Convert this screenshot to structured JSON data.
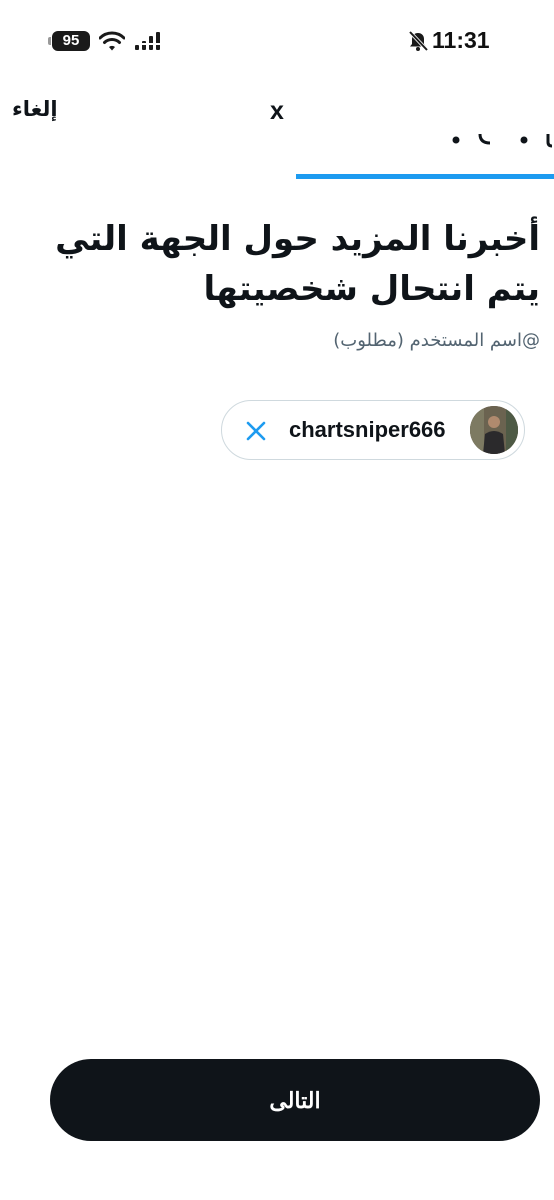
{
  "status_bar": {
    "battery": "95",
    "time": "11:31",
    "icons": [
      "wifi-icon",
      "signal-icon",
      "bell-off-icon"
    ]
  },
  "header": {
    "cancel_label": "إلغاء",
    "close_glyph": "x",
    "progress_color": "#1d9bf0"
  },
  "form": {
    "headline": "أخبرنا المزيد حول الجهة التي يتم انتحال شخصيتها",
    "field_label": "@اسم المستخدم (مطلوب)",
    "selected_user": {
      "username": "chartsniper666",
      "remove_icon": "close-icon",
      "avatar": "avatar"
    }
  },
  "footer": {
    "next_label": "التالى"
  },
  "colors": {
    "text": "#0f1419",
    "secondary_text": "#536471",
    "accent": "#1d9bf0",
    "button_bg": "#0f1419",
    "chip_border": "#cfd9de"
  }
}
